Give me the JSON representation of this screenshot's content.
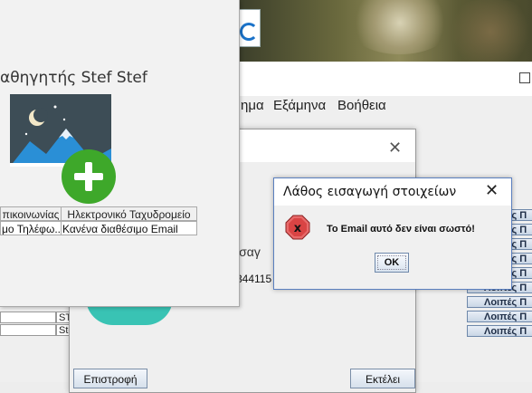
{
  "background_window": {
    "menu": [
      "ημα",
      "Εξάμηνα",
      "Βοήθεια"
    ],
    "list_buttons": [
      "Λοιπές Π",
      "Λοιπές Π",
      "Λοιπές Π",
      "Λοιπές Π",
      "Λοιπές Π",
      "Λοιπές Π",
      "Λοιπές Π",
      "Λοιπές Π",
      "Λοιπές Π",
      "Λοιπές Π"
    ],
    "left_rows": [
      "ST",
      "Ste"
    ]
  },
  "middle_dialog": {
    "partial_label": "ίσαγ",
    "partial_number": "344115",
    "back_button": "Επιστροφή",
    "submit_button": "Εκτέλει"
  },
  "teacher_window": {
    "title": "αθηγητής Stef Stef",
    "table": {
      "headers": [
        "πικοινωνίας",
        "Ηλεκτρονικό Ταχυδρομείο"
      ],
      "row": [
        "μο Τηλέφω...",
        "Κανένα διαθέσιμο Email"
      ]
    }
  },
  "error_dialog": {
    "title": "Λάθος εισαγωγή στοιχείων",
    "message": "Το Email αυτό δεν είναι σωστό!",
    "ok_label": "OK",
    "icon": "error-x-icon"
  }
}
